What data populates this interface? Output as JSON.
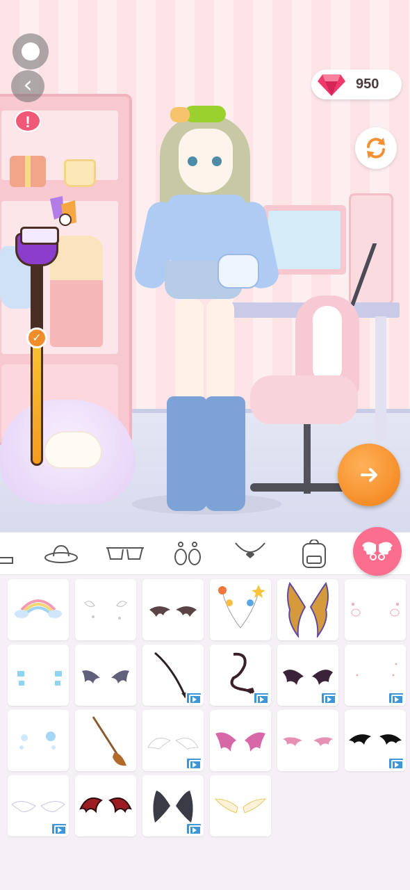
{
  "currency": {
    "gems": "950"
  },
  "colors": {
    "accent_pink": "#fb6e8e",
    "next_orange": "#f08c2a",
    "gem_red": "#ee3a6c",
    "ad_blue": "#3e95d8"
  },
  "slider": {
    "level": 0.55
  },
  "categories": [
    {
      "name": "shoes-icon",
      "selected": false
    },
    {
      "name": "hat-icon",
      "selected": false
    },
    {
      "name": "glasses-icon",
      "selected": false
    },
    {
      "name": "earrings-icon",
      "selected": false
    },
    {
      "name": "necklace-icon",
      "selected": false
    },
    {
      "name": "backpack-icon",
      "selected": false
    },
    {
      "name": "wings-icon",
      "selected": true
    }
  ],
  "items": [
    {
      "name": "rainbow-clouds",
      "ad": false
    },
    {
      "name": "white-sparkle-wings",
      "ad": false
    },
    {
      "name": "small-bat-wings",
      "ad": false
    },
    {
      "name": "balloon-antennae",
      "ad": false
    },
    {
      "name": "golden-feather-wings",
      "ad": false
    },
    {
      "name": "bunny-clips",
      "ad": false
    },
    {
      "name": "ice-crystals",
      "ad": false
    },
    {
      "name": "dark-bat-wings",
      "ad": false
    },
    {
      "name": "devil-tail",
      "ad": true
    },
    {
      "name": "curly-devil-tail",
      "ad": true
    },
    {
      "name": "purple-demon-wings",
      "ad": true
    },
    {
      "name": "tiny-sparkles",
      "ad": true
    },
    {
      "name": "snowflakes",
      "ad": false
    },
    {
      "name": "witch-broom",
      "ad": false
    },
    {
      "name": "white-feather-wings",
      "ad": true
    },
    {
      "name": "pink-demon-wings",
      "ad": false
    },
    {
      "name": "pink-bat-wings",
      "ad": false
    },
    {
      "name": "black-bat-wings",
      "ad": true
    },
    {
      "name": "angel-wings",
      "ad": true
    },
    {
      "name": "red-demon-wings",
      "ad": false
    },
    {
      "name": "black-feather-wings",
      "ad": true
    },
    {
      "name": "golden-angel-wings",
      "ad": false
    }
  ]
}
